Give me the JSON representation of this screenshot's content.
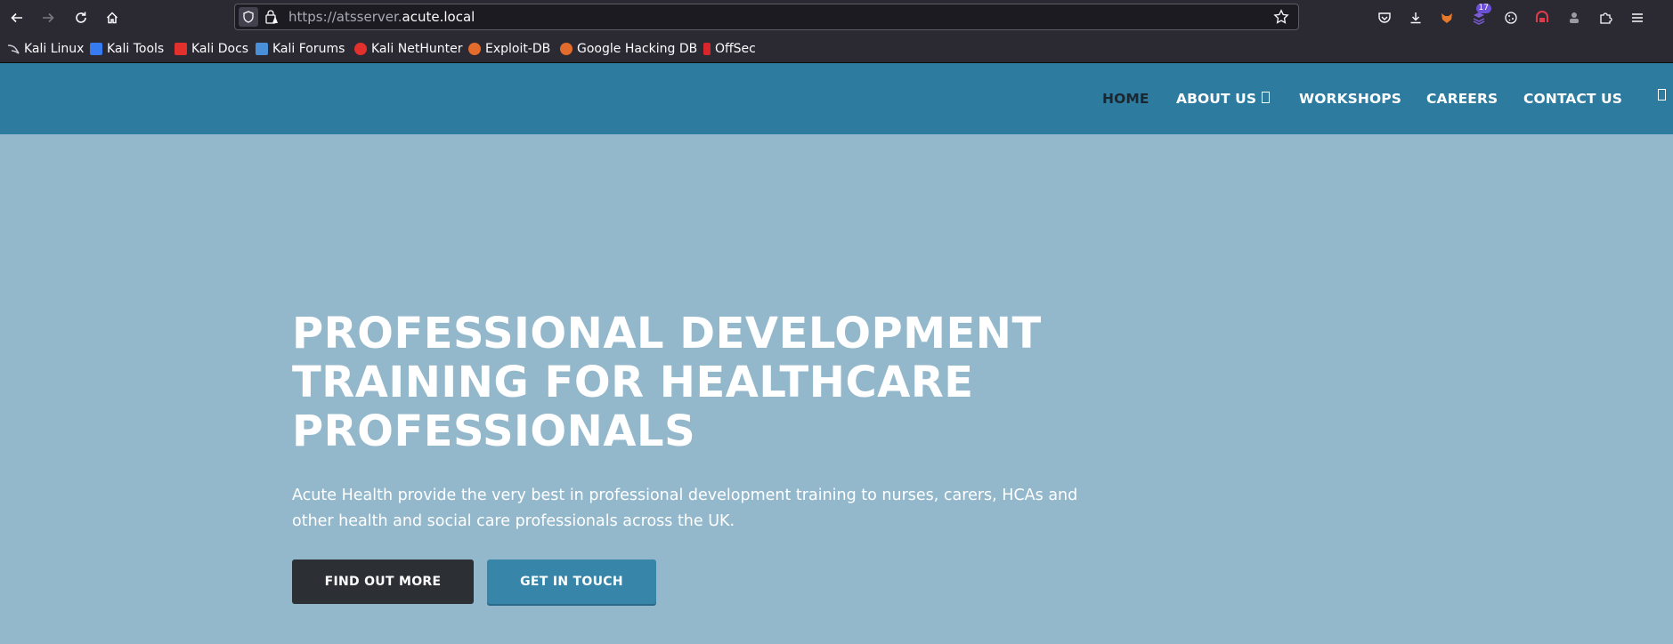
{
  "browser": {
    "url_prefix": "https://atsserver.",
    "url_domain": "acute.local",
    "extension_badge": "17"
  },
  "bookmarks": [
    {
      "label": "Kali Linux",
      "icon": "kali-dragon-icon",
      "color": "#9aa3ad"
    },
    {
      "label": "Kali Tools",
      "icon": "kali-tools-icon",
      "color": "#367bf0"
    },
    {
      "label": "Kali Docs",
      "icon": "kali-docs-icon",
      "color": "#e2312d"
    },
    {
      "label": "Kali Forums",
      "icon": "kali-forums-icon",
      "color": "#4a90d9"
    },
    {
      "label": "Kali NetHunter",
      "icon": "nethunter-icon",
      "color": "#e2312d"
    },
    {
      "label": "Exploit-DB",
      "icon": "exploit-db-icon",
      "color": "#e36b2c"
    },
    {
      "label": "Google Hacking DB",
      "icon": "ghdb-icon",
      "color": "#e36b2c"
    },
    {
      "label": "OffSec",
      "icon": "offsec-icon",
      "color": "#d9262c"
    }
  ],
  "site": {
    "menu": [
      {
        "label": "HOME",
        "active": true
      },
      {
        "label": "ABOUT US",
        "has_dropdown": true
      },
      {
        "label": "WORKSHOPS"
      },
      {
        "label": "CAREERS"
      },
      {
        "label": "CONTACT US"
      }
    ],
    "header_color": "#2d7ca0",
    "hero_background": "#93b8cc"
  },
  "hero": {
    "title_lines": [
      "PROFESSIONAL DEVELOPMENT",
      "TRAINING FOR HEALTHCARE",
      "PROFESSIONALS"
    ],
    "subtitle_lines": [
      "Acute Health provide the very best in professional development training to nurses, carers, HCAs and",
      "other health and social care professionals across the UK."
    ],
    "primary_button": "FIND OUT MORE",
    "secondary_button": "GET IN TOUCH"
  }
}
